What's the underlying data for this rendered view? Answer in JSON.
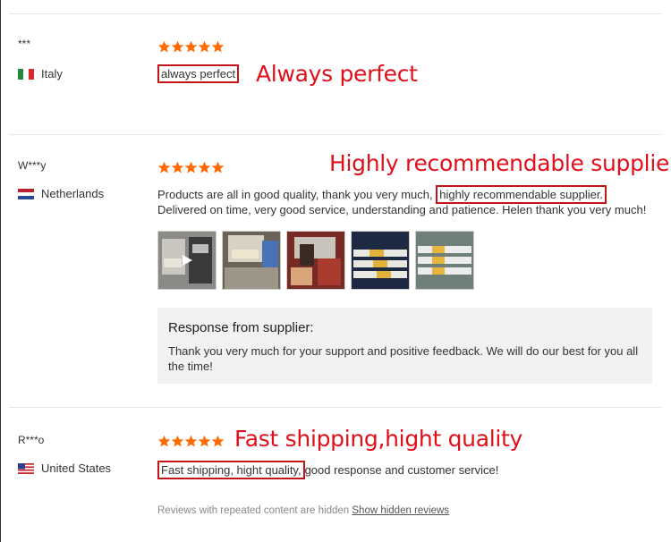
{
  "reviews": [
    {
      "author": "***",
      "country": "Italy",
      "rating": 5,
      "text_boxed": "always perfect",
      "annotation": "Always perfect"
    },
    {
      "author": "W***y",
      "country": "Netherlands",
      "rating": 5,
      "text_before": "Products are all in good quality, thank you very much,",
      "text_boxed": "highly recommendable supplier.",
      "text_after": "Delivered on time, very good service, understanding and patience. Helen thank you very much!",
      "annotation": "Highly recommendable supplier",
      "photo_count": 5,
      "response": {
        "title": "Response from supplier:",
        "body": "Thank you very much for your support and positive feedback. We will do our best for you all the time!"
      }
    },
    {
      "author": "R***o",
      "country": "United States",
      "rating": 5,
      "text_boxed": "Fast shipping, hight quality,",
      "text_after": "good response and customer service!",
      "annotation": "Fast shipping,hight quality"
    }
  ],
  "footer": {
    "note": "Reviews with repeated content are hidden",
    "link": "Show hidden reviews"
  },
  "colors": {
    "star": "#ff6a00",
    "annotation": "#e0101a",
    "box": "#c0161b"
  }
}
